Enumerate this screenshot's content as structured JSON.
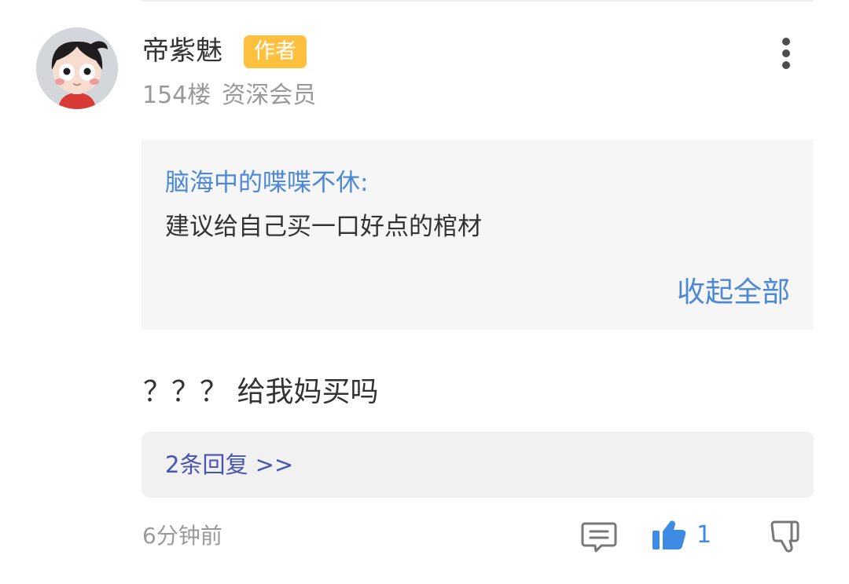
{
  "comment": {
    "username": "帝紫魅",
    "badge": "作者",
    "floor": "154楼",
    "member_level": "资深会员",
    "quote": {
      "author": "脑海中的喋喋不休:",
      "text": "建议给自己买一口好点的棺材",
      "collapse_label": "收起全部"
    },
    "text": "？？？ 给我妈买吗",
    "replies_label": "2条回复 >>",
    "time": "6分钟前",
    "like_count": "1"
  },
  "icons": {
    "avatar": "cartoon-boy-avatar",
    "more": "vertical-ellipsis-icon",
    "comment": "comment-bubble-icon",
    "like": "thumbs-up-icon",
    "dislike": "thumbs-down-icon"
  },
  "colors": {
    "badge": "#ffbf3f",
    "link_blue": "#4c88d6",
    "reply_link": "#4755b1",
    "like_active": "#3d8be3",
    "quote_bg": "#f6f6f6",
    "reply_bg": "#f1f1f1",
    "muted_text": "#999999",
    "main_text": "#333333"
  }
}
